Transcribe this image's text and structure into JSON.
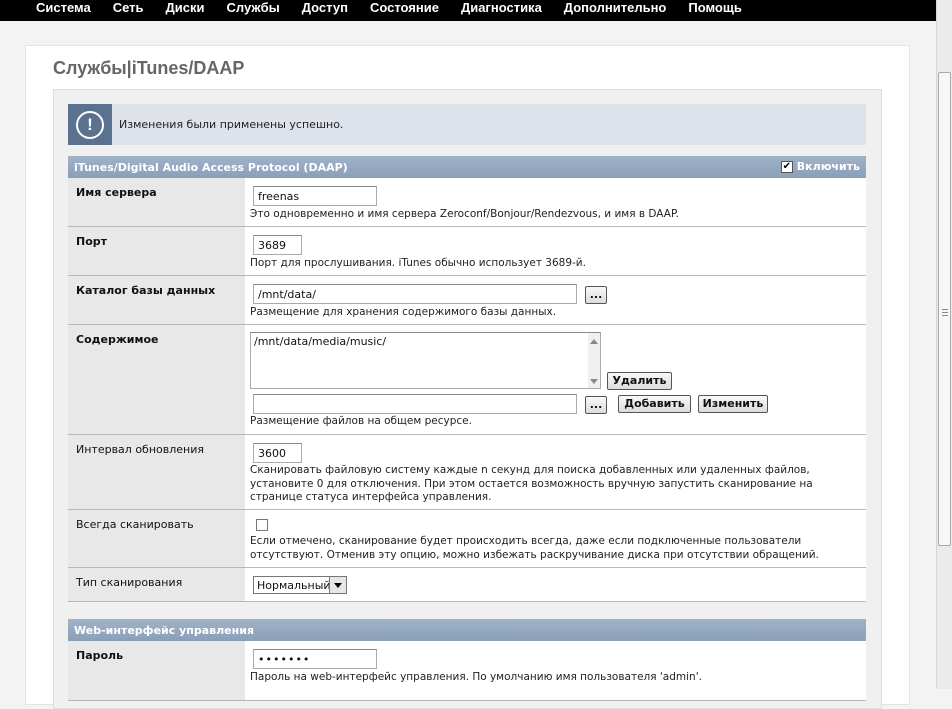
{
  "nav": {
    "items": [
      "Система",
      "Сеть",
      "Диски",
      "Службы",
      "Доступ",
      "Состояние",
      "Диагностика",
      "Дополнительно",
      "Помощь"
    ]
  },
  "page": {
    "title": "Службы|iTunes/DAAP"
  },
  "message": {
    "text": "Изменения были применены успешно.",
    "icon": "info-icon",
    "icon_glyph": "!"
  },
  "section_daap": {
    "title": "iTunes/Digital Audio Access Protocol (DAAP)",
    "enable_label": "Включить",
    "enable_checked": true,
    "check_glyph": "✔"
  },
  "rows": {
    "server_name": {
      "label": "Имя сервера",
      "value": "freenas",
      "desc": "Это одновременно и имя сервера Zeroconf/Bonjour/Rendezvous, и имя в DAAP."
    },
    "port": {
      "label": "Порт",
      "value": "3689",
      "desc": "Порт для прослушивания. iTunes обычно использует 3689-й."
    },
    "db_dir": {
      "label": "Каталог базы данных",
      "value": "/mnt/data/",
      "browse": "...",
      "desc": "Размещение для хранения содержимого базы данных."
    },
    "content": {
      "label": "Содержимое",
      "list_value": "/mnt/data/media/music/",
      "delete_label": "Удалить",
      "new_value": "",
      "browse": "...",
      "add_label": "Добавить",
      "change_label": "Изменить",
      "desc": "Размещение файлов на общем ресурсе."
    },
    "rescan": {
      "label": "Интервал обновления",
      "value": "3600",
      "desc": "Сканировать файловую систему каждые n секунд для поиска добавленных или удаленных файлов, установите 0 для отключения. При этом остается возможность вручную запустить сканирование на странице статуса интерфейса управления."
    },
    "always_scan": {
      "label": "Всегда сканировать",
      "checked": false,
      "desc": "Если отмечено, сканирование будет происходить всегда, даже если подключенные пользователи отсутствуют. Отменив эту опцию, можно избежать раскручивание диска при отсутствии обращений."
    },
    "scan_type": {
      "label": "Тип сканирования",
      "value": "Нормальный"
    }
  },
  "section_web": {
    "title": "Web-интерфейс управления"
  },
  "password": {
    "label": "Пароль",
    "value": "•••••••",
    "desc": "Пароль на web-интерфейс управления. По умолчанию имя пользователя 'admin'."
  },
  "colors": {
    "nav_bg": "#000000",
    "section_header": "#8fa4bc",
    "message_icon_bg": "#5a7190",
    "message_bg": "#dde2eb"
  }
}
